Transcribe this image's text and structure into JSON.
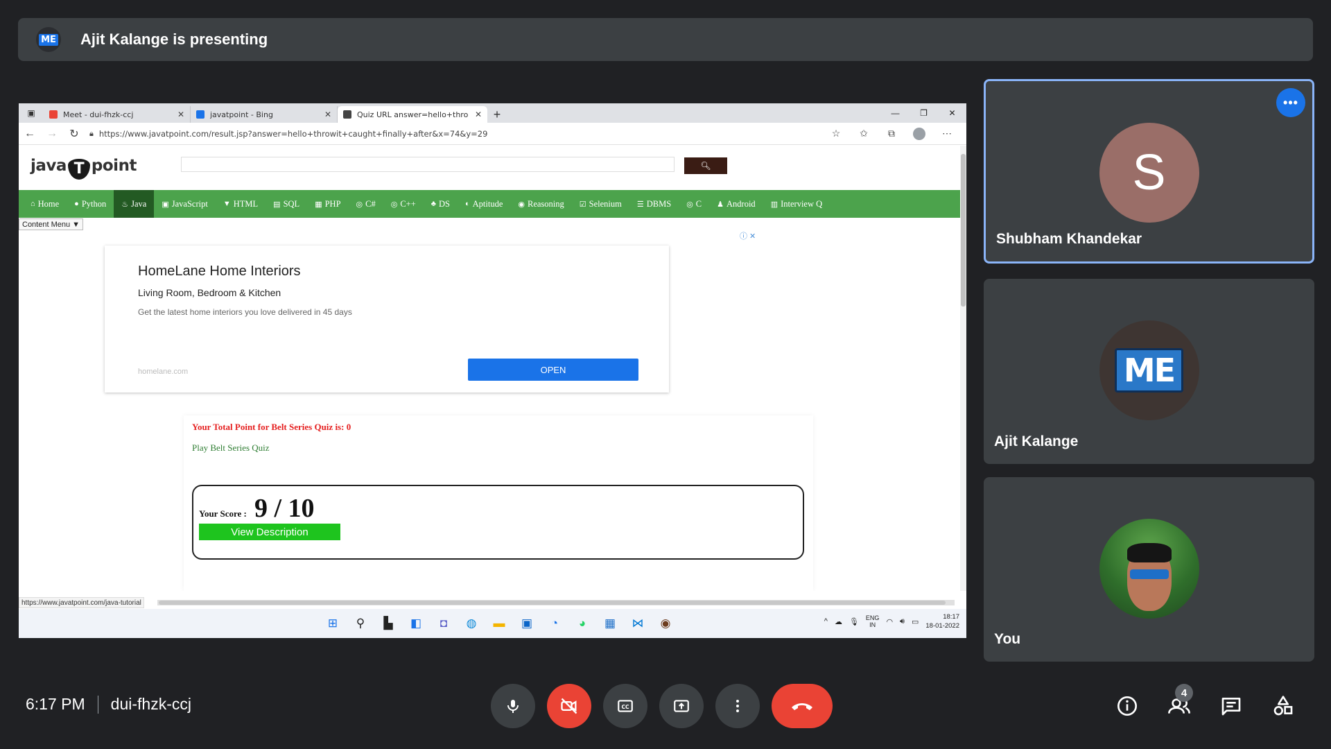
{
  "banner": {
    "badge": "ME",
    "title": "Ajit Kalange is presenting"
  },
  "browser": {
    "tabs": [
      {
        "label": "Meet - dui-fhzk-ccj",
        "favicon_color": "#ea4335"
      },
      {
        "label": "javatpoint - Bing",
        "favicon_color": "#1a73e8"
      },
      {
        "label": "Quiz URL answer=hello+throwit",
        "favicon_color": "#444444"
      }
    ],
    "new_tab": "+",
    "url": "https://www.javatpoint.com/result.jsp?answer=hello+throwit+caught+finally+after&x=74&y=29",
    "status_url": "https://www.javatpoint.com/java-tutorial"
  },
  "site": {
    "logo_left": "java",
    "logo_mid": "T",
    "logo_right": "point",
    "nav": [
      "Home",
      "Python",
      "Java",
      "JavaScript",
      "HTML",
      "SQL",
      "PHP",
      "C#",
      "C++",
      "DS",
      "Aptitude",
      "Reasoning",
      "Selenium",
      "DBMS",
      "C",
      "Android",
      "Interview Q"
    ],
    "active_nav": "Java",
    "content_menu": "Content Menu ▼"
  },
  "ad": {
    "choices": "ⓘ ✕",
    "heading": "HomeLane Home Interiors",
    "subheading": "Living Room, Bedroom & Kitchen",
    "description": "Get the latest home interiors you love delivered in 45 days",
    "domain": "homelane.com",
    "cta": "OPEN"
  },
  "quiz": {
    "total_points": "Your Total Point for Belt Series Quiz is: 0",
    "play_link": "Play Belt Series Quiz",
    "score_label": "Your Score :",
    "score_value": "9 / 10",
    "view_description": "View Description"
  },
  "taskbar": {
    "lang_line1": "ENG",
    "lang_line2": "IN",
    "time": "18:17",
    "date": "18-01-2022"
  },
  "participants": [
    {
      "name": "Shubham Khandekar",
      "initial": "S",
      "active": true
    },
    {
      "name": "Ajit Kalange",
      "logo": "ME"
    },
    {
      "name": "You"
    }
  ],
  "footer": {
    "time": "6:17 PM",
    "meeting_code": "dui-fhzk-ccj",
    "participant_count": "4"
  },
  "colors": {
    "accent": "#1a73e8",
    "danger": "#ea4335",
    "nav_green": "#4ca34c",
    "surface": "#3c4043",
    "background": "#202124"
  }
}
